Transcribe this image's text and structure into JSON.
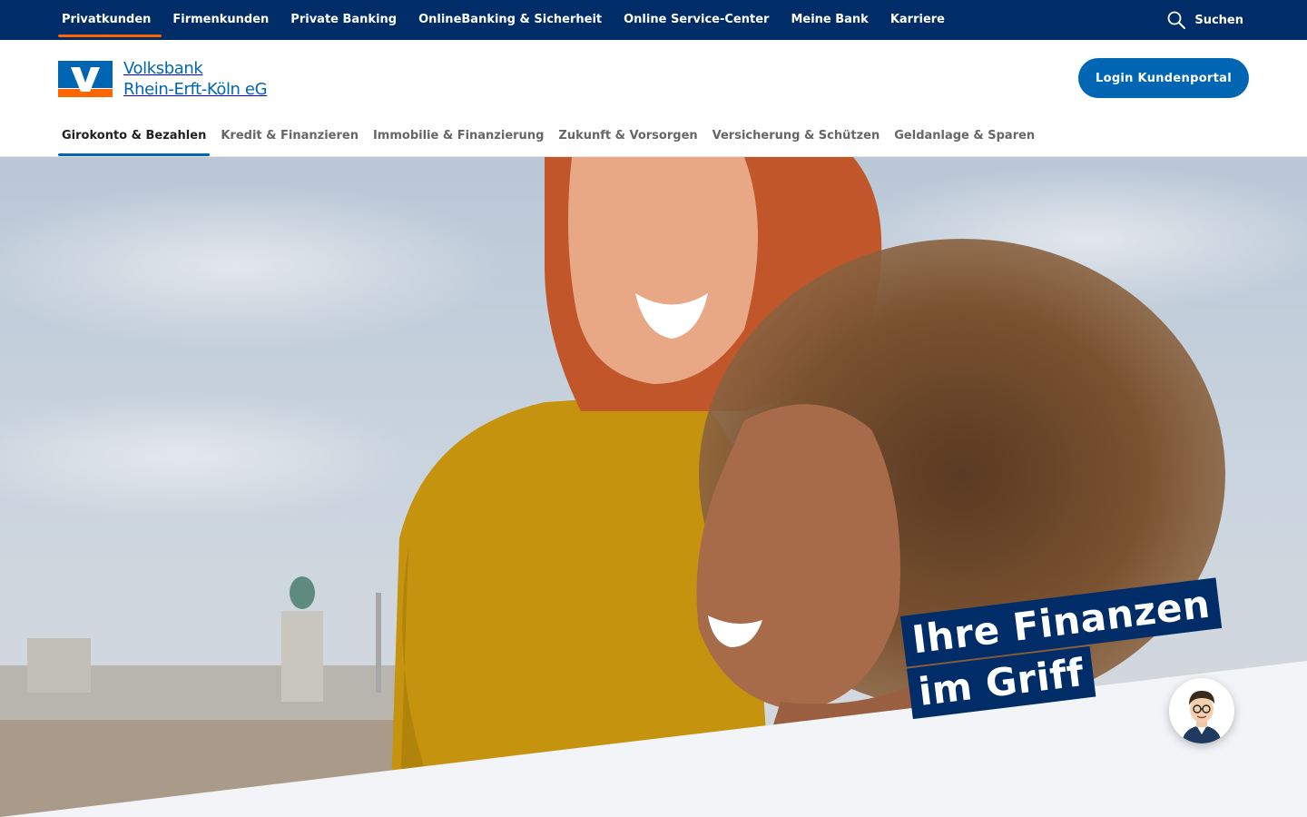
{
  "topnav": {
    "items": [
      {
        "label": "Privatkunden",
        "active": true
      },
      {
        "label": "Firmenkunden"
      },
      {
        "label": "Private Banking"
      },
      {
        "label": "OnlineBanking & Sicherheit"
      },
      {
        "label": "Online Service-Center"
      },
      {
        "label": "Meine Bank"
      },
      {
        "label": "Karriere"
      }
    ],
    "search_label": "Suchen",
    "search_icon": "search-icon"
  },
  "logo": {
    "line1": "Volksbank",
    "line2": "Rhein-Erft-Köln eG"
  },
  "login": {
    "label": "Login Kundenportal"
  },
  "mainnav": {
    "items": [
      {
        "label": "Girokonto & Bezahlen",
        "active": true
      },
      {
        "label": "Kredit & Finanzieren"
      },
      {
        "label": "Immobilie & Finanzierung"
      },
      {
        "label": "Zukunft & Vorsorgen"
      },
      {
        "label": "Versicherung & Schützen"
      },
      {
        "label": "Geldanlage & Sparen"
      }
    ]
  },
  "hero": {
    "headline_line1": "Ihre Finanzen",
    "headline_line2": "im Griff"
  },
  "colors": {
    "brand_dark": "#002d67",
    "brand_blue": "#0066b3",
    "accent_orange": "#ff6600"
  }
}
